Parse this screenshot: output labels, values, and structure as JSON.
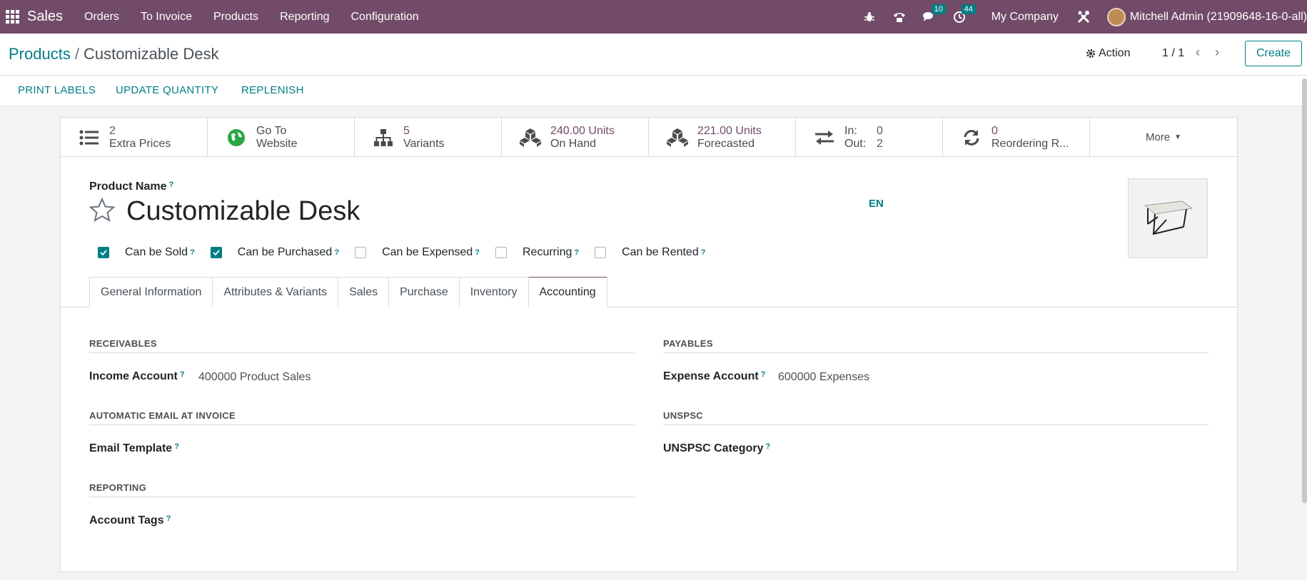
{
  "navbar": {
    "app_name": "Sales",
    "menu": [
      "Orders",
      "To Invoice",
      "Products",
      "Reporting",
      "Configuration"
    ],
    "messages_count": "10",
    "activities_count": "44",
    "company": "My Company",
    "user": "Mitchell Admin (21909648-16-0-all)"
  },
  "control": {
    "breadcrumb_parent": "Products",
    "breadcrumb_sep": "/",
    "breadcrumb_current": "Customizable Desk",
    "action_label": "Action",
    "pager": "1 / 1",
    "create_label": "Create"
  },
  "header_buttons": [
    "PRINT LABELS",
    "UPDATE QUANTITY",
    "REPLENISH"
  ],
  "smart_buttons": {
    "extra_prices": {
      "value": "2",
      "label": "Extra Prices"
    },
    "website": {
      "value": "Go To",
      "label": "Website"
    },
    "variants": {
      "value": "5",
      "label": "Variants"
    },
    "on_hand": {
      "value": "240.00 Units",
      "label": "On Hand"
    },
    "forecasted": {
      "value": "221.00 Units",
      "label": "Forecasted"
    },
    "in_out": {
      "in_label": "In:",
      "in_value": "0",
      "out_label": "Out:",
      "out_value": "2"
    },
    "reordering": {
      "value": "0",
      "label": "Reordering R..."
    },
    "more": "More"
  },
  "product": {
    "name_label": "Product Name",
    "qmark": "?",
    "title": "Customizable Desk",
    "lang": "EN"
  },
  "checkboxes": [
    {
      "label": "Can be Sold",
      "checked": true
    },
    {
      "label": "Can be Purchased",
      "checked": true
    },
    {
      "label": "Can be Expensed",
      "checked": false
    },
    {
      "label": "Recurring",
      "checked": false
    },
    {
      "label": "Can be Rented",
      "checked": false
    }
  ],
  "tabs": [
    "General Information",
    "Attributes & Variants",
    "Sales",
    "Purchase",
    "Inventory",
    "Accounting"
  ],
  "accounting": {
    "receivables_title": "RECEIVABLES",
    "income_label": "Income Account",
    "income_value": "400000 Product Sales",
    "auto_email_title": "AUTOMATIC EMAIL AT INVOICE",
    "email_template_label": "Email Template",
    "reporting_title": "REPORTING",
    "account_tags_label": "Account Tags",
    "payables_title": "PAYABLES",
    "expense_label": "Expense Account",
    "expense_value": "600000 Expenses",
    "unspsc_title": "UNSPSC",
    "unspsc_label": "UNSPSC Category"
  },
  "colors": {
    "brand": "#714b67",
    "accent": "#017e84"
  }
}
